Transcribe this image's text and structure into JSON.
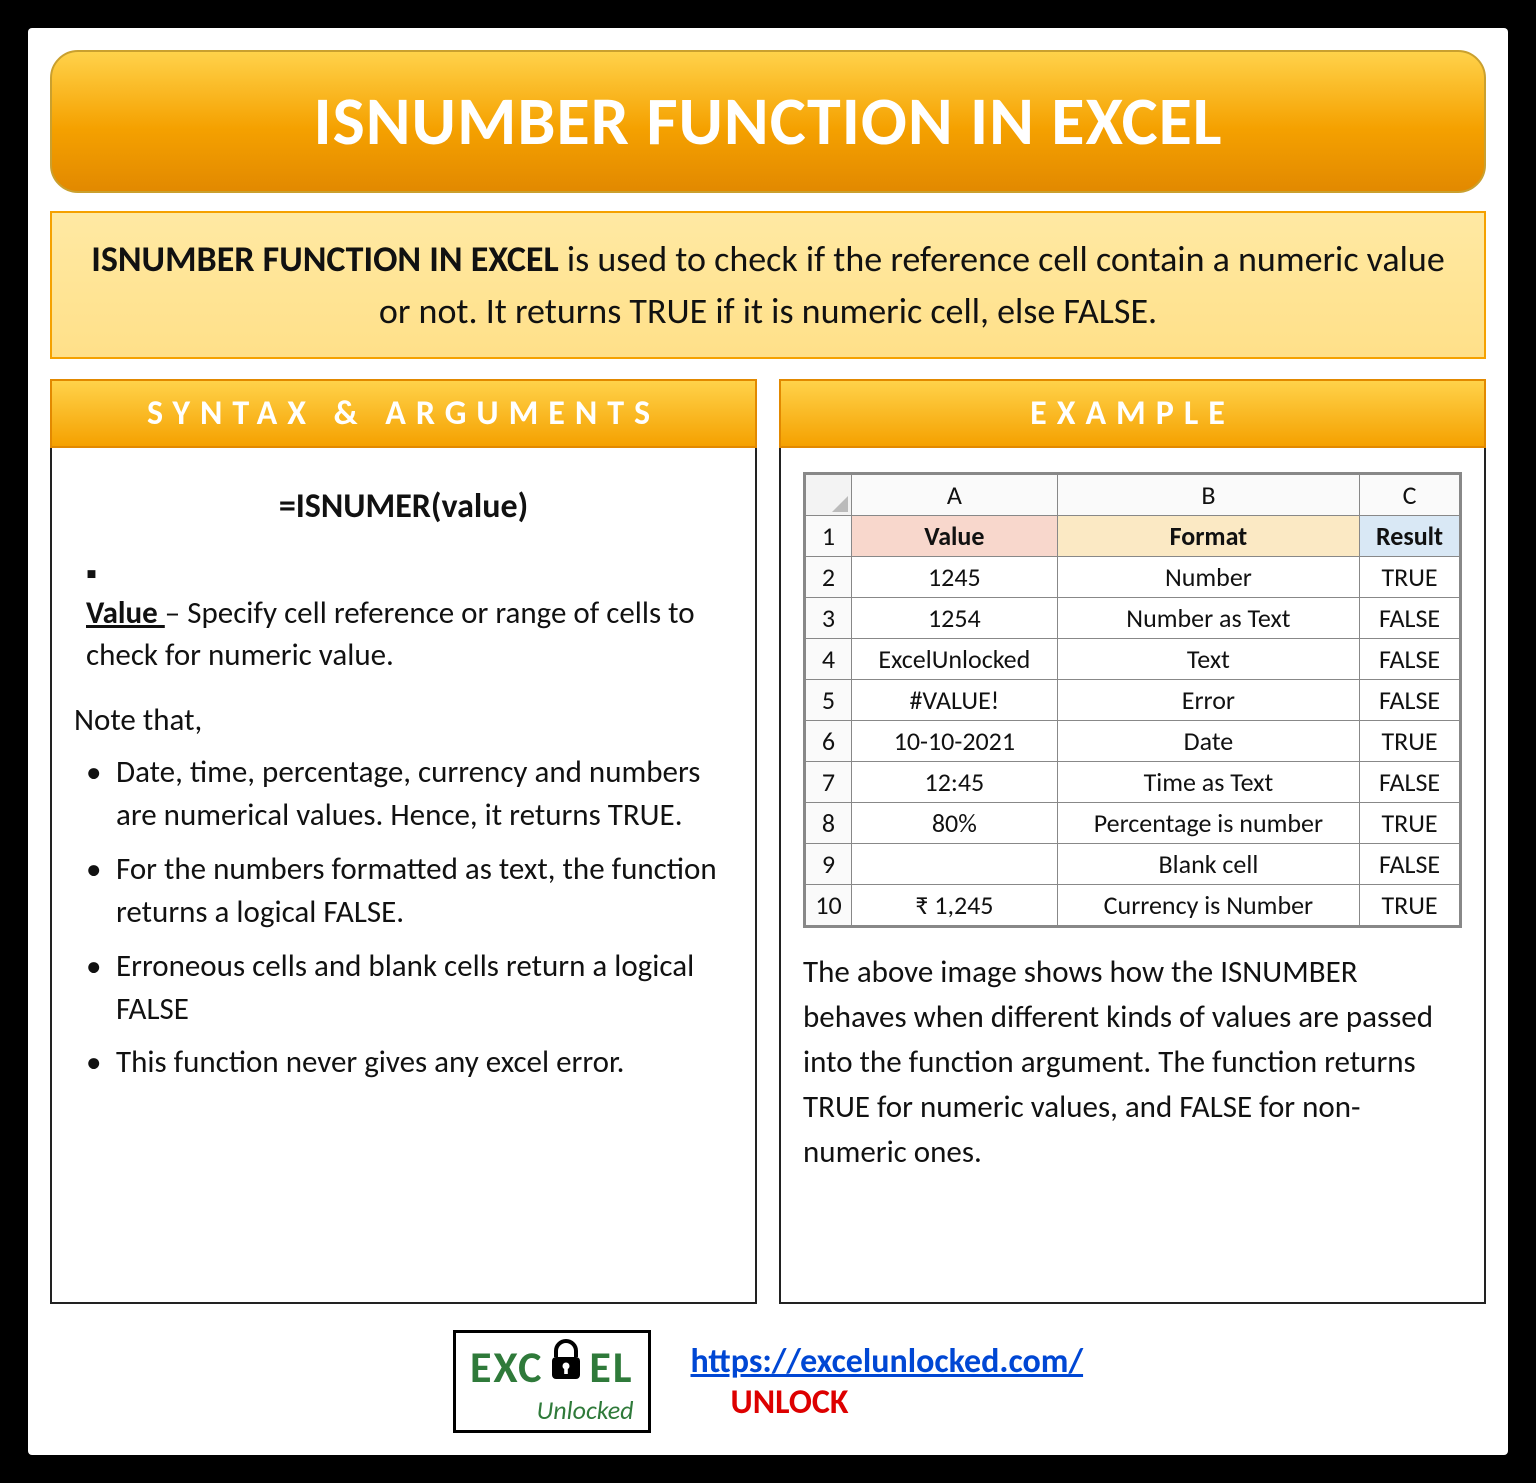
{
  "title": "ISNUMBER FUNCTION IN EXCEL",
  "intro_strong": "ISNUMBER FUNCTION IN EXCEL",
  "intro_rest": " is used to check if the reference cell contain a numeric value or not. It returns TRUE if it is numeric cell, else FALSE.",
  "syntax": {
    "heading": "SYNTAX & ARGUMENTS",
    "formula": "=ISNUMER(value)",
    "arg_bullet": "▪",
    "arg_name": "Value ",
    "arg_desc": "– Specify cell reference or range of cells to check for numeric value.",
    "note_lead": "Note that,",
    "notes": [
      "Date, time, percentage, currency and numbers are numerical values. Hence, it returns TRUE.",
      "For the numbers formatted as text, the function returns a logical FALSE.",
      "Erroneous cells and blank cells return a logical FALSE",
      "This function never gives any excel error."
    ]
  },
  "example": {
    "heading": "EXAMPLE",
    "col_labels": {
      "a": "A",
      "b": "B",
      "c": "C"
    },
    "hrow": {
      "value": "Value",
      "format": "Format",
      "result": "Result"
    },
    "rows": [
      {
        "rn": "2",
        "value": "1245",
        "format": "Number",
        "result": "TRUE"
      },
      {
        "rn": "3",
        "value": "1254",
        "format": "Number as Text",
        "result": "FALSE"
      },
      {
        "rn": "4",
        "value": "ExcelUnlocked",
        "format": "Text",
        "result": "FALSE"
      },
      {
        "rn": "5",
        "value": "#VALUE!",
        "format": "Error",
        "result": "FALSE"
      },
      {
        "rn": "6",
        "value": "10-10-2021",
        "format": "Date",
        "result": "TRUE"
      },
      {
        "rn": "7",
        "value": "12:45",
        "format": "Time as Text",
        "result": "FALSE"
      },
      {
        "rn": "8",
        "value": "80%",
        "format": "Percentage is number",
        "result": "TRUE"
      },
      {
        "rn": "9",
        "value": "",
        "format": "Blank cell",
        "result": "FALSE"
      },
      {
        "rn": "10",
        "value": "₹ 1,245",
        "format": "Currency is Number",
        "result": "TRUE"
      }
    ],
    "hrow_num": "1",
    "caption": "The above image shows how the ISNUMBER behaves when different kinds of values are passed into the function argument. The function returns TRUE for numeric values, and FALSE for non-numeric ones."
  },
  "footer": {
    "logo_top_left": "EXC",
    "logo_top_right": "EL",
    "logo_bottom": "Unlocked",
    "url": "https://excelunlocked.com/",
    "unlock": "UNLOCK"
  }
}
